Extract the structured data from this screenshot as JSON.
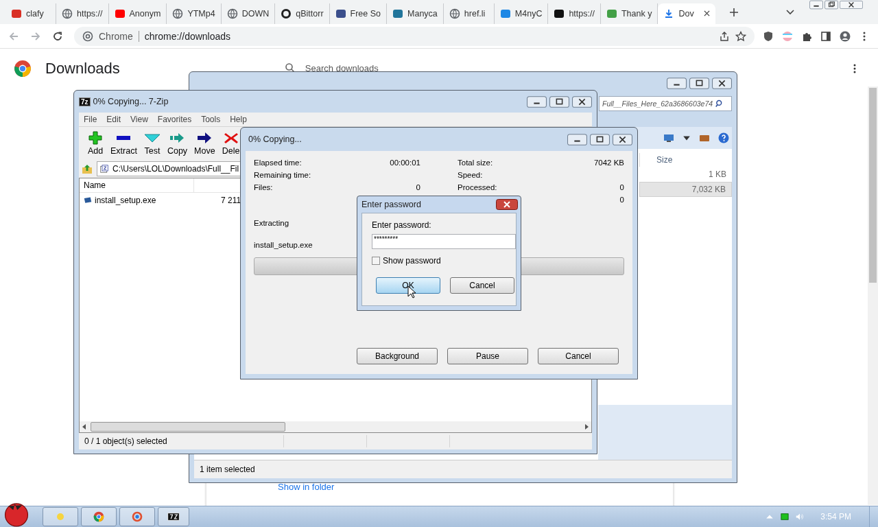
{
  "browser": {
    "tabs": [
      {
        "label": "clafy",
        "kind": "favicon",
        "color": "#d93025",
        "selected": false
      },
      {
        "label": "https://",
        "kind": "globe",
        "selected": false
      },
      {
        "label": "Anonym",
        "kind": "favicon",
        "color": "#ff0000",
        "selected": false
      },
      {
        "label": "YTMp4",
        "kind": "globe",
        "selected": false
      },
      {
        "label": "DOWN",
        "kind": "globe",
        "selected": false
      },
      {
        "label": "qBittorr",
        "kind": "ring",
        "color": "#222222",
        "selected": false
      },
      {
        "label": "Free So",
        "kind": "favicon",
        "color": "#3b4f8c",
        "selected": false
      },
      {
        "label": "Manyca",
        "kind": "favicon",
        "color": "#21759b",
        "selected": false
      },
      {
        "label": "href.li",
        "kind": "globe",
        "selected": false
      },
      {
        "label": "M4nyC",
        "kind": "favicon",
        "color": "#1e88e5",
        "selected": false
      },
      {
        "label": "https://",
        "kind": "favicon",
        "color": "#111111",
        "selected": false
      },
      {
        "label": "Thank y",
        "kind": "favicon",
        "color": "#43a047",
        "selected": false
      },
      {
        "label": "Dov",
        "kind": "download",
        "selected": true
      }
    ],
    "site_chip": "Chrome",
    "url": "chrome://downloads"
  },
  "page": {
    "title": "Downloads",
    "search_placeholder": "Search downloads",
    "link": "Show in folder"
  },
  "explorer": {
    "search": "Full__Files_Here_62a3686603e74",
    "column": "Size",
    "rows": [
      {
        "size": "1 KB",
        "selected": false
      },
      {
        "size": "7,032 KB",
        "selected": true
      }
    ],
    "status": "1 item selected"
  },
  "zip": {
    "title": "0% Copying... 7-Zip",
    "logo": "7z",
    "menu": [
      "File",
      "Edit",
      "View",
      "Favorites",
      "Tools",
      "Help"
    ],
    "tools": [
      {
        "label": "Add",
        "kind": "add"
      },
      {
        "label": "Extract",
        "kind": "extract"
      },
      {
        "label": "Test",
        "kind": "test"
      },
      {
        "label": "Copy",
        "kind": "copy"
      },
      {
        "label": "Move",
        "kind": "move"
      },
      {
        "label": "Dele",
        "kind": "delete"
      }
    ],
    "path": "C:\\Users\\LOL\\Downloads\\Full__Fil",
    "column": "Name",
    "files": [
      {
        "name": "install_setup.exe",
        "size": "7 211"
      }
    ],
    "status": "0 / 1 object(s) selected"
  },
  "progress": {
    "title": "0% Copying...",
    "left": [
      {
        "label": "Elapsed time:",
        "value": "00:00:01"
      },
      {
        "label": "Remaining time:"
      },
      {
        "label": "Files:",
        "value": "0"
      }
    ],
    "right": [
      {
        "label": "Total size:",
        "value": "7042 KB"
      },
      {
        "label": "Speed:"
      },
      {
        "label": "Processed:",
        "value": "0"
      },
      {
        "value": "0"
      }
    ],
    "action": "Extracting",
    "file": "install_setup.exe",
    "level": 0,
    "buttons": [
      "Background",
      "Pause",
      "Cancel"
    ]
  },
  "password": {
    "title": "Enter password",
    "label": "Enter password:",
    "value": "*********",
    "show_password": {
      "label": "Show password",
      "checked": false
    },
    "buttons": [
      {
        "label": "OK",
        "selected": true
      },
      {
        "label": "Cancel",
        "selected": false
      }
    ]
  },
  "taskbar": {
    "time": "3:54 PM"
  }
}
